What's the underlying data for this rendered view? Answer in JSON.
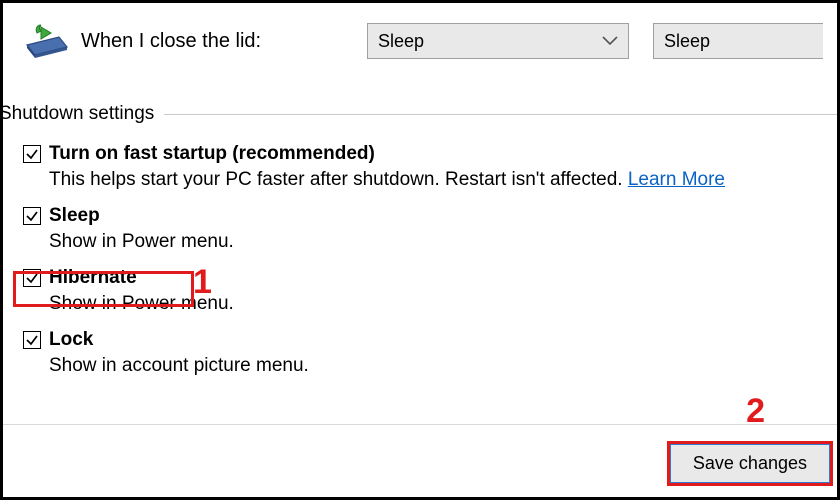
{
  "top": {
    "icon": "laptop-lid-icon",
    "label": "When I close the lid:",
    "combo1": "Sleep",
    "combo2": "Sleep"
  },
  "section_title": "Shutdown settings",
  "settings": {
    "fast_startup": {
      "label": "Turn on fast startup (recommended)",
      "desc": "This helps start your PC faster after shutdown. Restart isn't affected. ",
      "link": "Learn More"
    },
    "sleep": {
      "label": "Sleep",
      "desc": "Show in Power menu."
    },
    "hibernate": {
      "label": "Hibernate",
      "desc": "Show in Power menu."
    },
    "lock": {
      "label": "Lock",
      "desc": "Show in account picture menu."
    }
  },
  "save_button": "Save changes",
  "callouts": {
    "one": "1",
    "two": "2"
  }
}
